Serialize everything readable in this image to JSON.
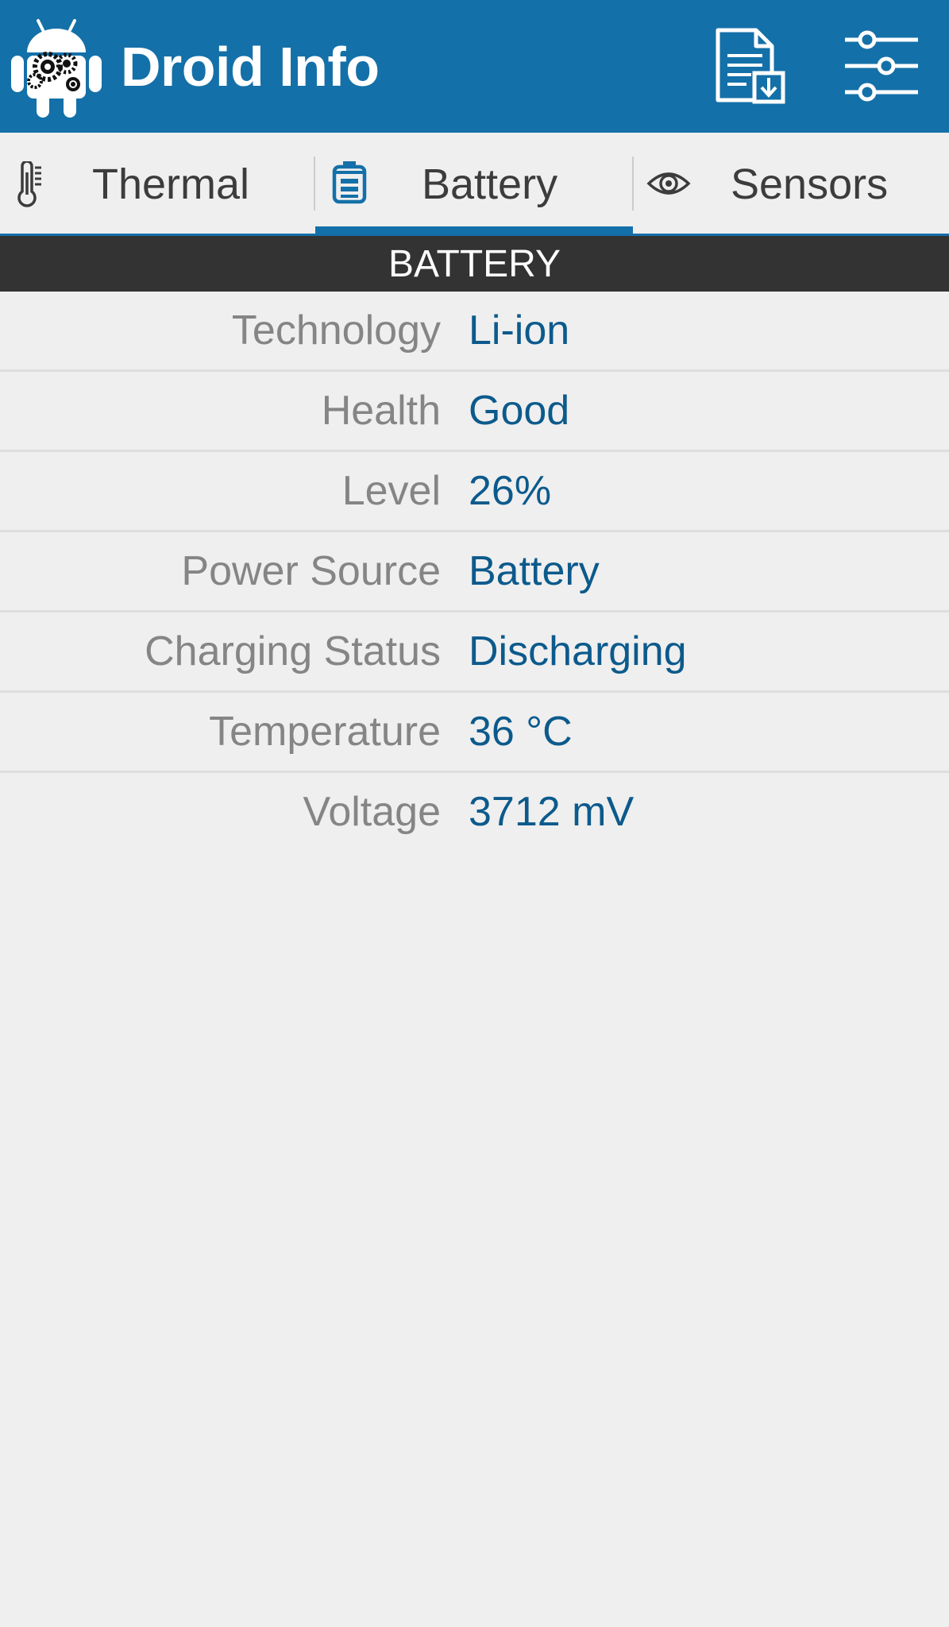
{
  "app": {
    "title": "Droid Info",
    "colors": {
      "primary": "#1470a8",
      "value_text": "#0c5a8c",
      "label_text": "#858585",
      "header_bg": "#333333"
    },
    "icons": {
      "logo": "android-gears-logo",
      "export": "export-report-icon",
      "settings": "sliders-icon"
    }
  },
  "tabs": [
    {
      "label": "Thermal",
      "icon": "thermometer-icon",
      "selected": false
    },
    {
      "label": "Battery",
      "icon": "battery-icon",
      "selected": true
    },
    {
      "label": "Sensors",
      "icon": "eye-icon",
      "selected": false
    }
  ],
  "section": {
    "title": "BATTERY"
  },
  "rows": [
    {
      "label": "Technology",
      "value": "Li-ion"
    },
    {
      "label": "Health",
      "value": "Good"
    },
    {
      "label": "Level",
      "value": "26%"
    },
    {
      "label": "Power Source",
      "value": "Battery"
    },
    {
      "label": "Charging Status",
      "value": "Discharging"
    },
    {
      "label": "Temperature",
      "value": "36 °C"
    },
    {
      "label": "Voltage",
      "value": "3712 mV"
    }
  ]
}
